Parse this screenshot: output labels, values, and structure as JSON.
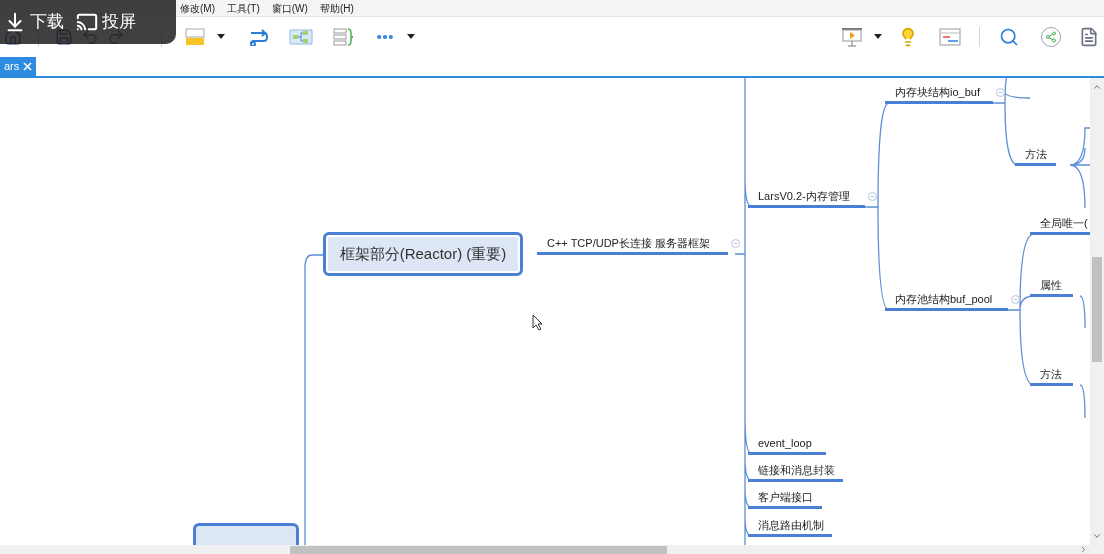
{
  "overlay": {
    "buttons": [
      {
        "kind": "download",
        "label": "下载"
      },
      {
        "kind": "cast",
        "label": "投屏"
      }
    ]
  },
  "menu": [
    "修改(M)",
    "工具(T)",
    "窗口(W)",
    "帮助(H)"
  ],
  "tabs": [
    {
      "label": "ars",
      "selected": true
    }
  ],
  "mindmap": {
    "root": {
      "label": "框架部分(Reactor) (重要)",
      "selected": true,
      "children": [
        {
          "label": "C++ TCP/UDP长连接 服务器框架",
          "children": [
            {
              "label": "LarsV0.2-内存管理",
              "children": [
                {
                  "label": "内存块结构io_buf",
                  "children": [
                    {
                      "label": "方法"
                    }
                  ]
                },
                {
                  "label": "内存池结构buf_pool",
                  "children": [
                    {
                      "label": "全局唯一("
                    },
                    {
                      "label": "属性"
                    },
                    {
                      "label": "方法"
                    }
                  ]
                }
              ]
            },
            {
              "label": "event_loop"
            },
            {
              "label": "链接和消息封装"
            },
            {
              "label": "客户端接口"
            },
            {
              "label": "消息路由机制"
            }
          ]
        }
      ]
    }
  }
}
